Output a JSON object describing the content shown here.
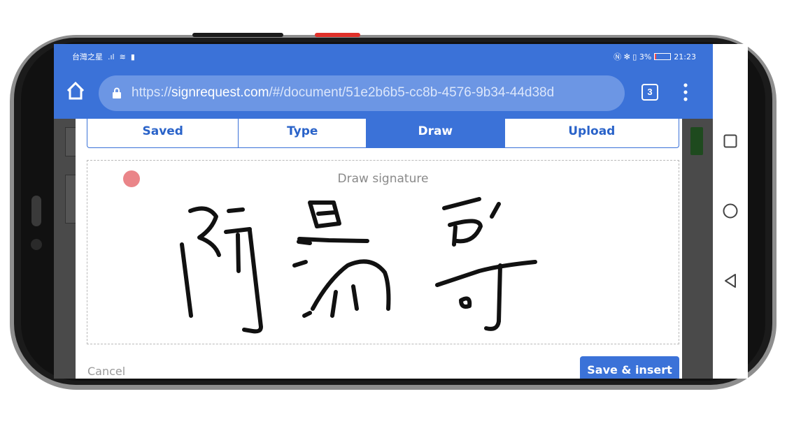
{
  "status_bar": {
    "carrier": "台灣之星",
    "right_text": "3%",
    "time": "21:23"
  },
  "browser": {
    "url_scheme": "https://",
    "url_host": "signrequest.com",
    "url_path": "/#/document/51e2b6b5-cc8b-4576-9b34-44d38d",
    "tab_count": "3",
    "icons": [
      "home-icon",
      "lock-icon",
      "overflow-menu-icon"
    ]
  },
  "signature_modal": {
    "tabs": [
      {
        "label": "Saved",
        "active": false
      },
      {
        "label": "Type",
        "active": false
      },
      {
        "label": "Draw",
        "active": true
      },
      {
        "label": "Upload",
        "active": false
      }
    ],
    "draw_placeholder": "Draw signature",
    "pen_color": "#ea8589",
    "cancel_label": "Cancel",
    "save_label": "Save & insert"
  },
  "navigation_bar": {
    "icons": [
      "recents-square-icon",
      "home-circle-icon",
      "back-triangle-icon"
    ]
  },
  "colors": {
    "accent": "#3b72d8",
    "ink": "#111111"
  }
}
